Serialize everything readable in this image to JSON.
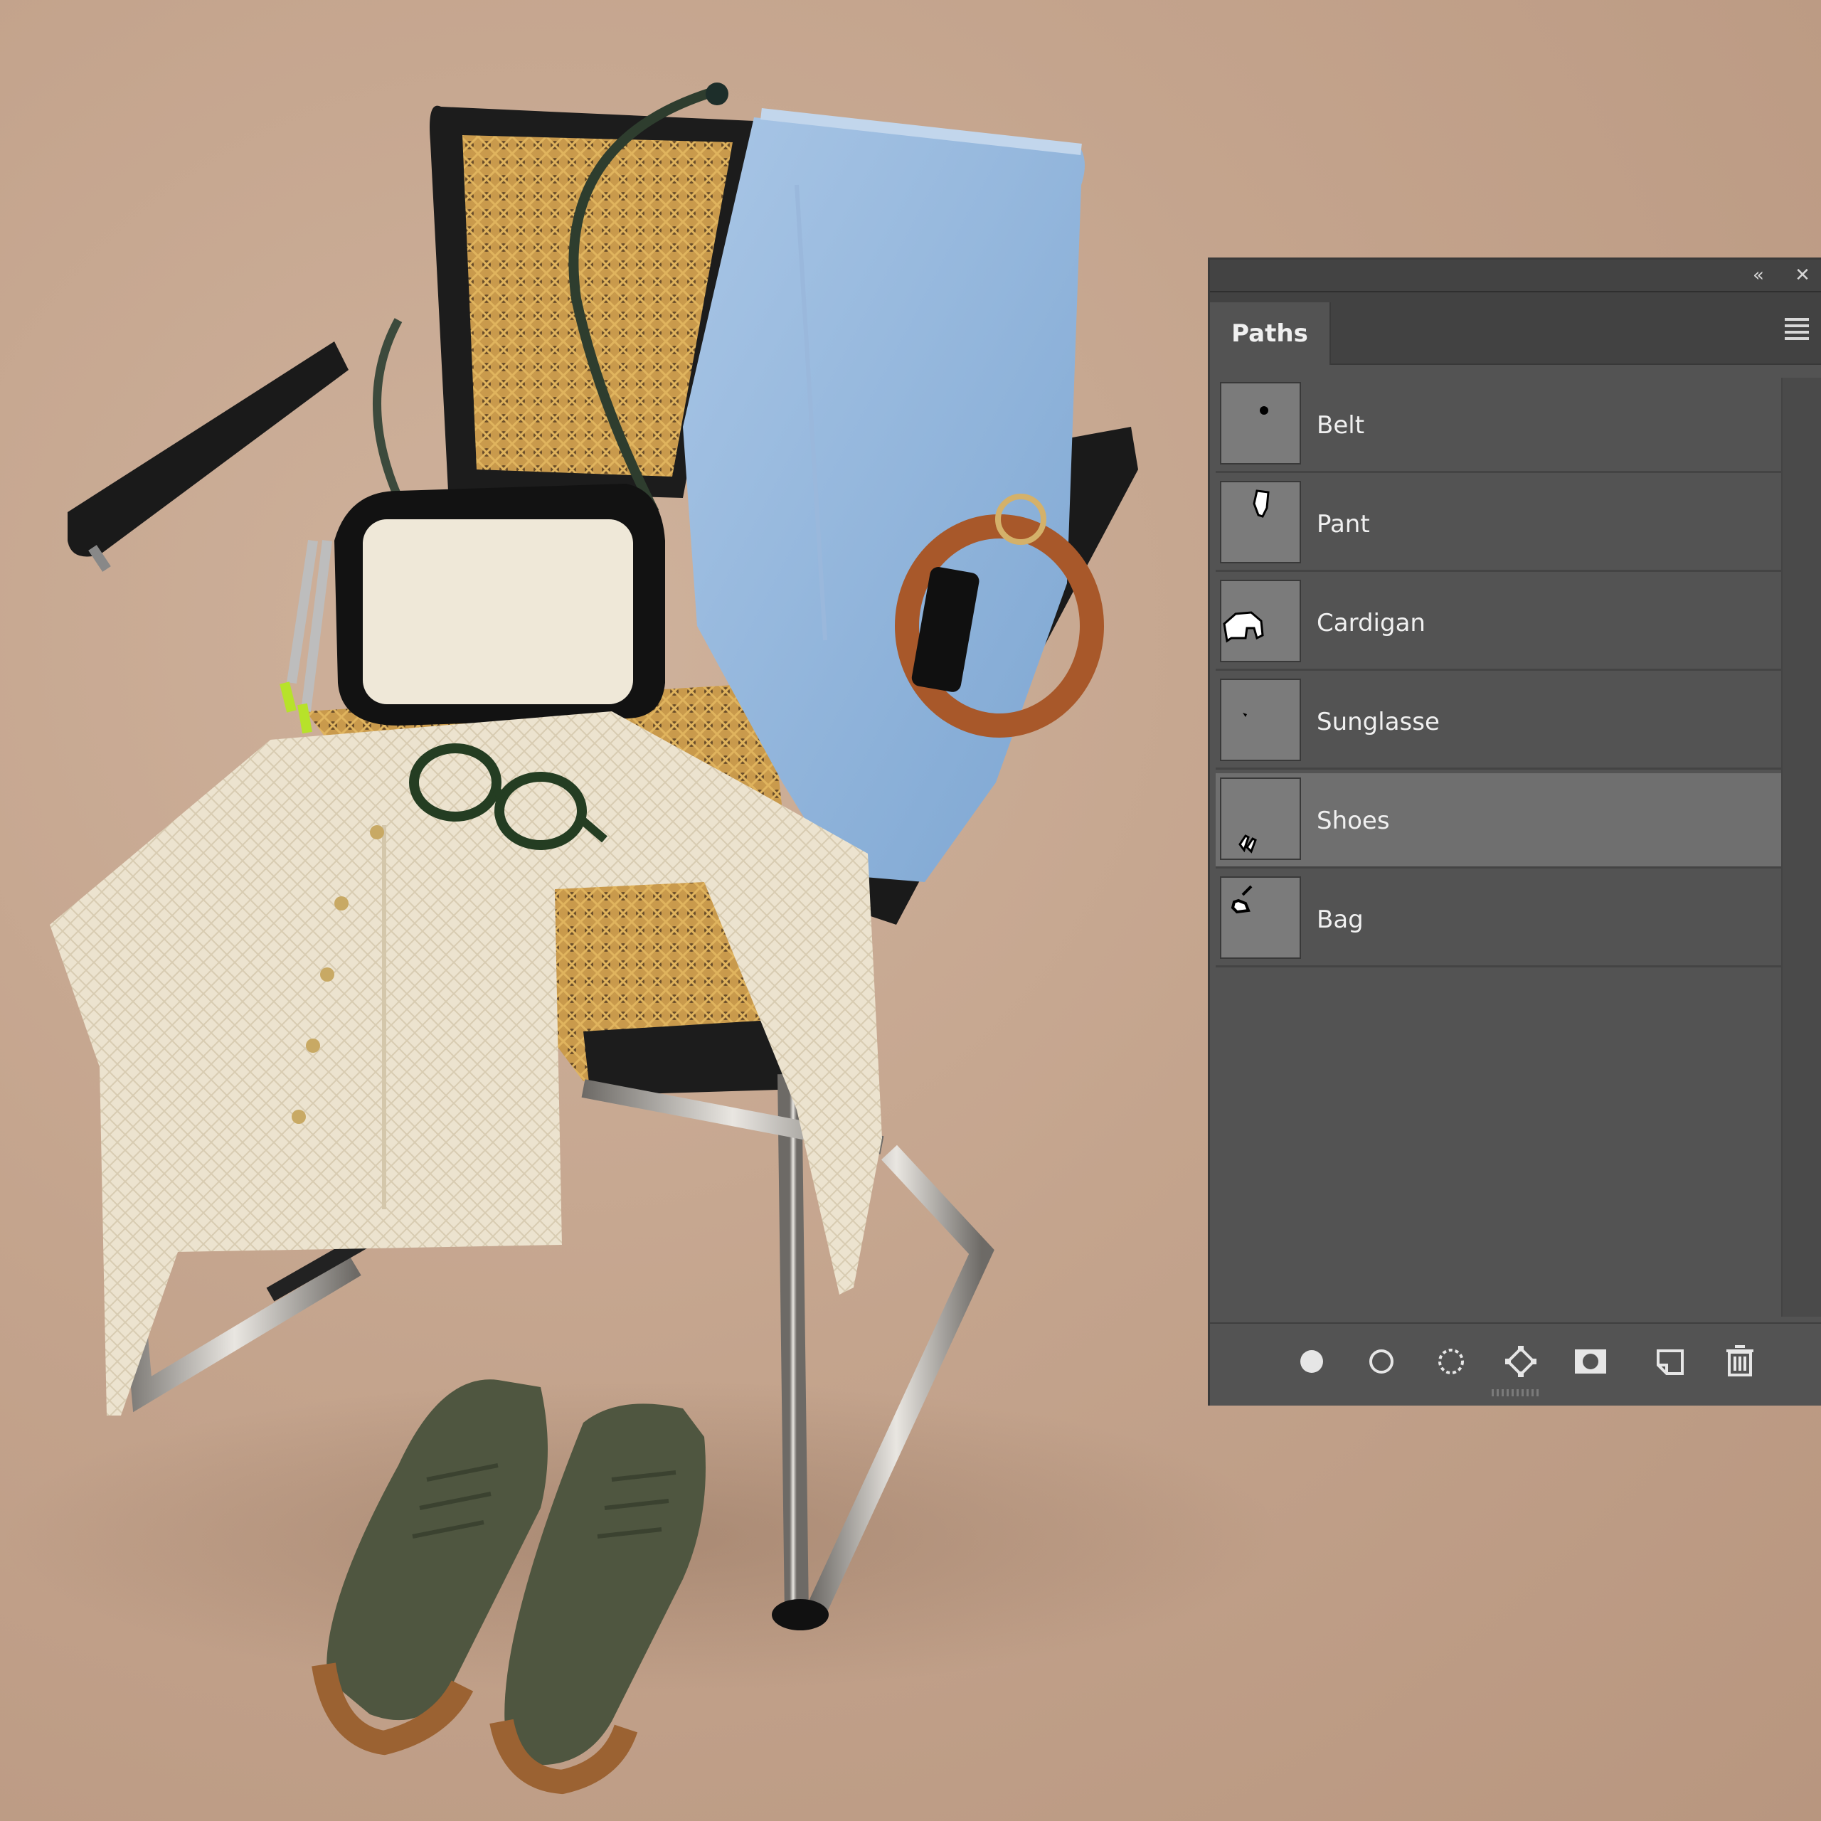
{
  "panel": {
    "tab_label": "Paths",
    "collapse_glyph": "«",
    "close_glyph": "✕",
    "menu_icon": "panel-menu-icon"
  },
  "paths": [
    {
      "label": "Belt",
      "selected": false,
      "icon": "belt-path-thumbnail"
    },
    {
      "label": "Pant",
      "selected": false,
      "icon": "pant-path-thumbnail"
    },
    {
      "label": "Cardigan",
      "selected": false,
      "icon": "cardigan-path-thumbnail"
    },
    {
      "label": "Sunglasse",
      "selected": false,
      "icon": "sunglasse-path-thumbnail"
    },
    {
      "label": "Shoes",
      "selected": true,
      "icon": "shoes-path-thumbnail"
    },
    {
      "label": "Bag",
      "selected": false,
      "icon": "bag-path-thumbnail"
    }
  ],
  "footer_tools": [
    "fill-path-icon",
    "stroke-path-icon",
    "load-path-as-selection-icon",
    "make-work-path-icon",
    "add-mask-icon",
    "create-new-path-icon",
    "delete-path-icon"
  ],
  "colors": {
    "background": "#c4a48d",
    "panel": "#535353",
    "panel_dark": "#424242",
    "selected_row": "#6f6f6f",
    "text": "#f0f0f0"
  }
}
